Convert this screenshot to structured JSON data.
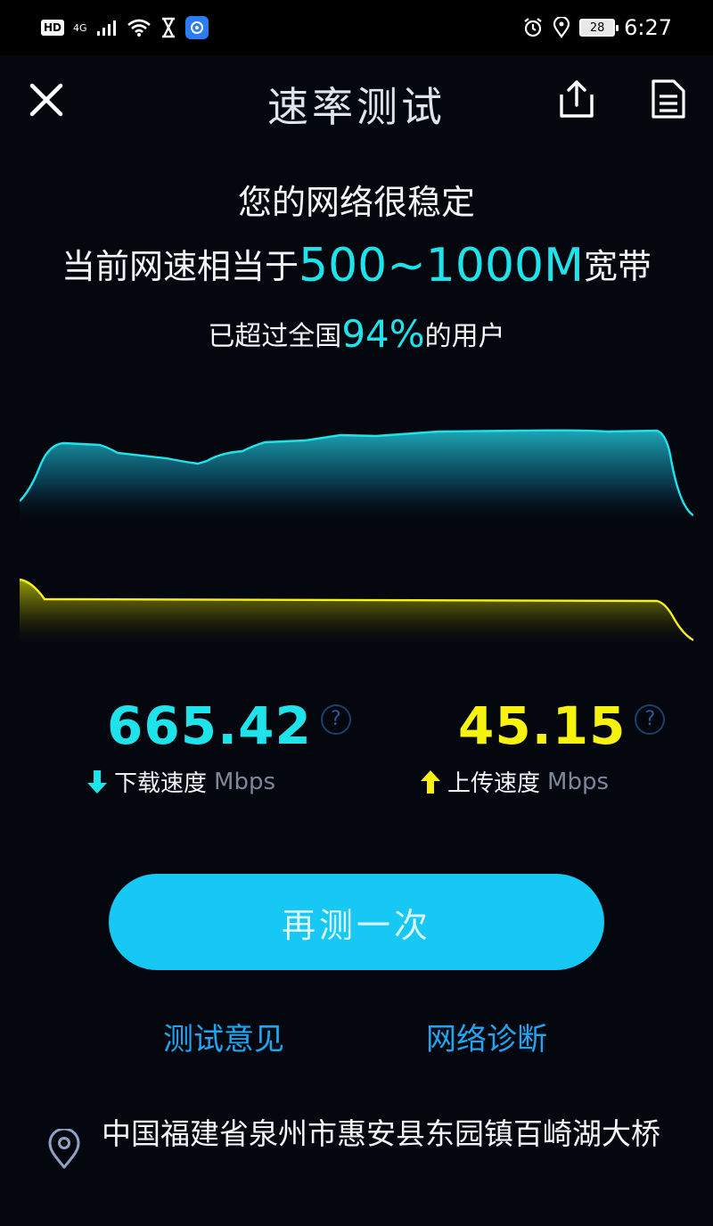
{
  "status_bar": {
    "hd_badge": "HD",
    "network_type": "4G",
    "battery_level": "28",
    "time": "6:27"
  },
  "header": {
    "title": "速率测试"
  },
  "result": {
    "headline": "您的网络很稳定",
    "equiv_prefix": "当前网速相当于",
    "equiv_highlight": "500~1000M",
    "equiv_suffix": "宽带",
    "beat_prefix": "已超过全国",
    "beat_highlight": "94%",
    "beat_suffix": "的用户"
  },
  "speeds": {
    "download_value": "665.42",
    "download_label": "下载速度",
    "download_unit": "Mbps",
    "upload_value": "45.15",
    "upload_label": "上传速度",
    "upload_unit": "Mbps",
    "help_glyph": "?"
  },
  "actions": {
    "retest_label": "再测一次",
    "feedback_label": "测试意见",
    "diagnose_label": "网络诊断"
  },
  "location": {
    "address": "中国福建省泉州市惠安县东园镇百崎湖大桥"
  },
  "colors": {
    "download_accent": "#1fe3ea",
    "upload_accent": "#f7f20e",
    "button_bg": "#16c8f3",
    "link": "#1ea6f4",
    "background": "#05070f"
  },
  "icons": {
    "close": "close-icon",
    "share": "share-icon",
    "report": "report-icon",
    "help": "help-icon",
    "download_arrow": "arrow-down-icon",
    "upload_arrow": "arrow-up-icon",
    "location": "location-pin-icon"
  }
}
